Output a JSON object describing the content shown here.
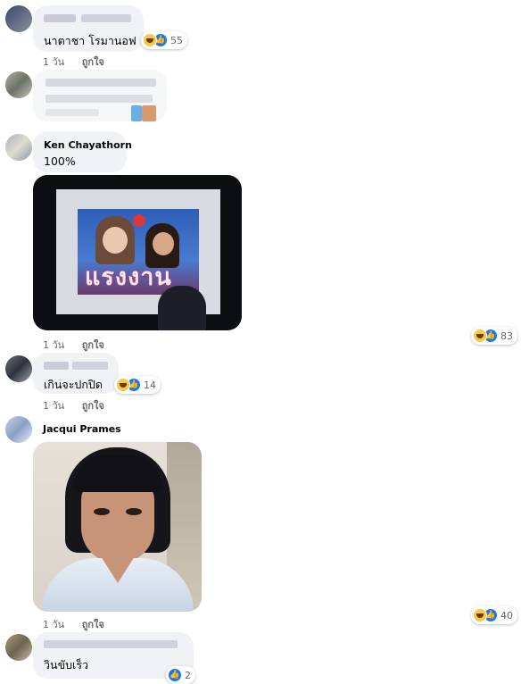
{
  "comments": [
    {
      "author": "",
      "text": "นาตาชา โรมานอฟ",
      "time": "1 วัน",
      "like_label": "ถูกใจ",
      "reaction_count": "55"
    },
    {
      "author": "",
      "text": "",
      "time": "",
      "like_label": "",
      "reaction_count": ""
    },
    {
      "author": "Ken Chayathorn",
      "text": "100%",
      "time": "1 วัน",
      "like_label": "ถูกใจ",
      "reaction_count": "83",
      "image_text": "แรงงาน"
    },
    {
      "author": "",
      "text": "เกินจะปกปิด",
      "time": "1 วัน",
      "like_label": "ถูกใจ",
      "reaction_count": "14"
    },
    {
      "author": "Jacqui Prames",
      "text": "",
      "time": "1 วัน",
      "like_label": "ถูกใจ",
      "reaction_count": "40"
    },
    {
      "author": "",
      "text": "วินขับเร็ว",
      "time": "",
      "like_label": "",
      "reaction_count": "2"
    }
  ],
  "icons": {
    "haha": "haha-reaction-icon",
    "like": "like-reaction-icon"
  },
  "colors": {
    "bubble": "#f0f2f5",
    "meta_text": "#65676b",
    "like_blue": "#1877f2",
    "haha_yellow": "#f7c94b"
  }
}
